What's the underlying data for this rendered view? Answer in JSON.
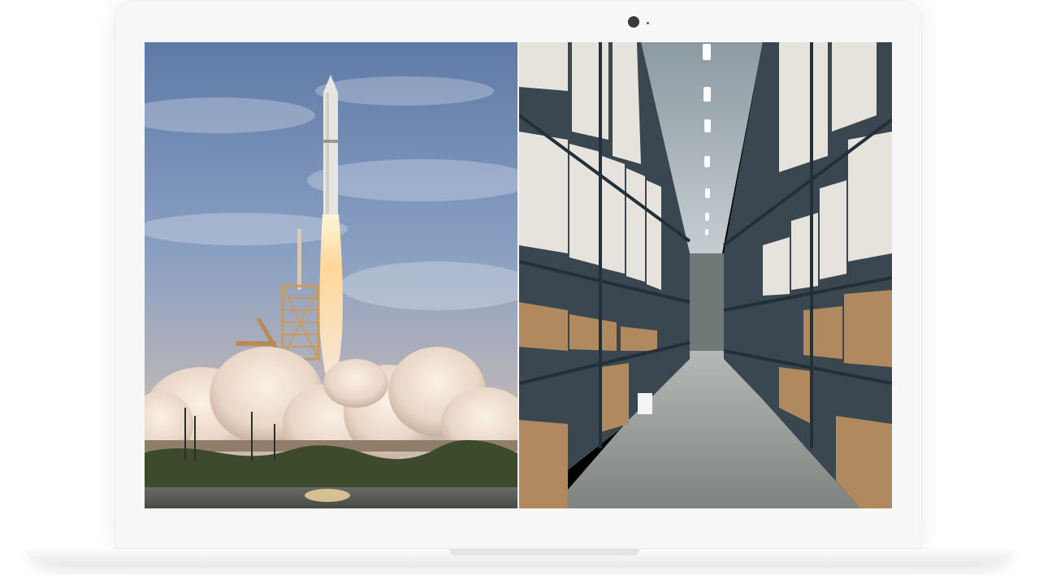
{
  "device": {
    "type": "laptop-mockup",
    "frame_color": "#f7f7f8"
  },
  "screen": {
    "images": [
      {
        "name": "rocket-launch-photo",
        "description_icon": "rocket-launch-image"
      },
      {
        "name": "warehouse-aisle-photo",
        "description_icon": "warehouse-image"
      }
    ]
  },
  "colors": {
    "sky_top": "#6e87b0",
    "sky_bottom": "#c9b8a8",
    "smoke": "#f1e4d8",
    "warehouse_shelf": "#2d3b45",
    "warehouse_floor": "#9a9d9c"
  }
}
